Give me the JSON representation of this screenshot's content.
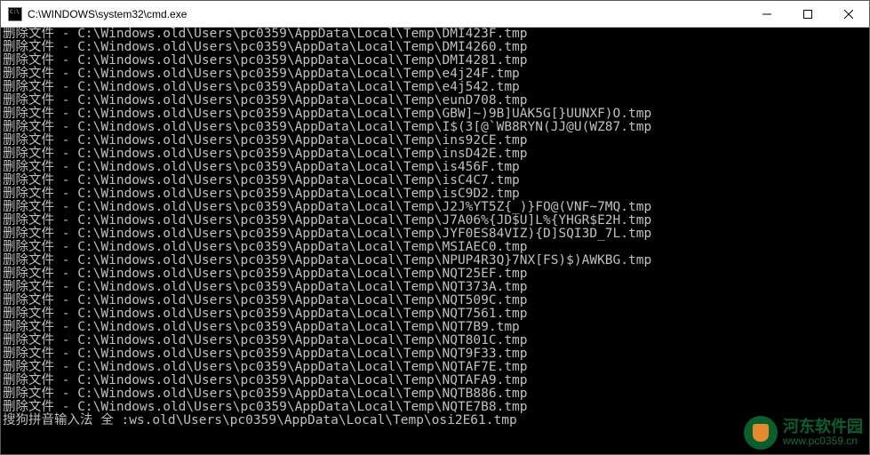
{
  "window": {
    "title": "C:\\WINDOWS\\system32\\cmd.exe"
  },
  "terminal": {
    "prefix": "删除文件 - ",
    "status_prefix": "搜狗拼音输入法 全 :",
    "lines": [
      "C:\\Windows.old\\Users\\pc0359\\AppData\\Local\\Temp\\DMI423F.tmp",
      "C:\\Windows.old\\Users\\pc0359\\AppData\\Local\\Temp\\DMI4260.tmp",
      "C:\\Windows.old\\Users\\pc0359\\AppData\\Local\\Temp\\DMI4281.tmp",
      "C:\\Windows.old\\Users\\pc0359\\AppData\\Local\\Temp\\e4j24F.tmp",
      "C:\\Windows.old\\Users\\pc0359\\AppData\\Local\\Temp\\e4j542.tmp",
      "C:\\Windows.old\\Users\\pc0359\\AppData\\Local\\Temp\\eunD708.tmp",
      "C:\\Windows.old\\Users\\pc0359\\AppData\\Local\\Temp\\GBW]~)9B]UAK5G[}UUNXF)O.tmp",
      "C:\\Windows.old\\Users\\pc0359\\AppData\\Local\\Temp\\I$(3[@`WB8RYN(JJ@U(WZ87.tmp",
      "C:\\Windows.old\\Users\\pc0359\\AppData\\Local\\Temp\\ins92CE.tmp",
      "C:\\Windows.old\\Users\\pc0359\\AppData\\Local\\Temp\\insD42E.tmp",
      "C:\\Windows.old\\Users\\pc0359\\AppData\\Local\\Temp\\is456F.tmp",
      "C:\\Windows.old\\Users\\pc0359\\AppData\\Local\\Temp\\isC4C7.tmp",
      "C:\\Windows.old\\Users\\pc0359\\AppData\\Local\\Temp\\isC9D2.tmp",
      "C:\\Windows.old\\Users\\pc0359\\AppData\\Local\\Temp\\J2J%YT5Z{_)}FO@(VNF~7MQ.tmp",
      "C:\\Windows.old\\Users\\pc0359\\AppData\\Local\\Temp\\J7A06%{JD$U]L%{YHGR$E2H.tmp",
      "C:\\Windows.old\\Users\\pc0359\\AppData\\Local\\Temp\\JYF0ES84VIZ){D]SQI3D_7L.tmp",
      "C:\\Windows.old\\Users\\pc0359\\AppData\\Local\\Temp\\MSIAEC0.tmp",
      "C:\\Windows.old\\Users\\pc0359\\AppData\\Local\\Temp\\NPUP4R3Q}7NX[FS)$)AWKBG.tmp",
      "C:\\Windows.old\\Users\\pc0359\\AppData\\Local\\Temp\\NQT25EF.tmp",
      "C:\\Windows.old\\Users\\pc0359\\AppData\\Local\\Temp\\NQT373A.tmp",
      "C:\\Windows.old\\Users\\pc0359\\AppData\\Local\\Temp\\NQT509C.tmp",
      "C:\\Windows.old\\Users\\pc0359\\AppData\\Local\\Temp\\NQT7561.tmp",
      "C:\\Windows.old\\Users\\pc0359\\AppData\\Local\\Temp\\NQT7B9.tmp",
      "C:\\Windows.old\\Users\\pc0359\\AppData\\Local\\Temp\\NQT801C.tmp",
      "C:\\Windows.old\\Users\\pc0359\\AppData\\Local\\Temp\\NQT9F33.tmp",
      "C:\\Windows.old\\Users\\pc0359\\AppData\\Local\\Temp\\NQTAF7E.tmp",
      "C:\\Windows.old\\Users\\pc0359\\AppData\\Local\\Temp\\NQTAFA9.tmp",
      "C:\\Windows.old\\Users\\pc0359\\AppData\\Local\\Temp\\NQTB886.tmp",
      "C:\\Windows.old\\Users\\pc0359\\AppData\\Local\\Temp\\NQTE7B8.tmp"
    ],
    "status_line": "ws.old\\Users\\pc0359\\AppData\\Local\\Temp\\osi2E61.tmp"
  },
  "watermark": {
    "cn": "河东软件园",
    "url": "www.pc0359.cn"
  }
}
